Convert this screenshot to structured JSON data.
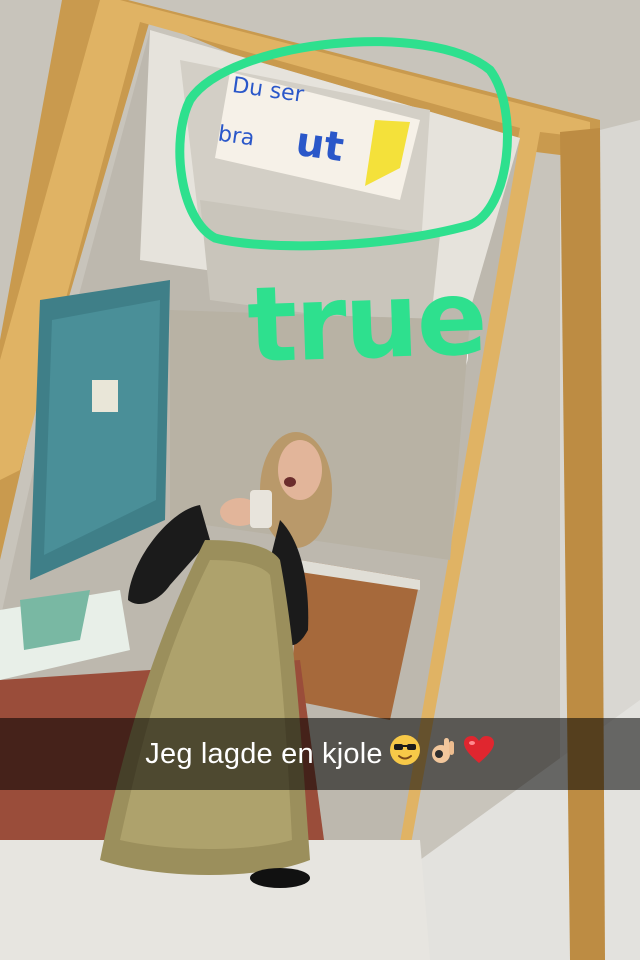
{
  "photo": {
    "sign_text": [
      "Du ser",
      "bra",
      "ut"
    ],
    "doodle_text": "true",
    "doodle_color": "#2ee08e"
  },
  "caption": {
    "text": "Jeg lagde en kjole",
    "emojis": [
      "sunglasses-face",
      "ok-hand",
      "red-heart"
    ]
  }
}
